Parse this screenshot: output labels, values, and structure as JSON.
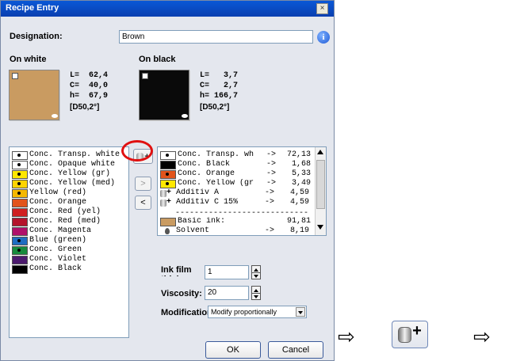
{
  "window": {
    "title": "Recipe Entry",
    "close_glyph": "×"
  },
  "designation": {
    "label": "Designation:",
    "value": "Brown",
    "info_glyph": "i"
  },
  "on_white": {
    "label": "On white",
    "swatch_color": "#c99b61",
    "metrics": [
      "L=  62,4",
      "C=  40,0",
      "h=  67,9"
    ],
    "illuminant": "[D50,2°]"
  },
  "on_black": {
    "label": "On black",
    "swatch_color": "#0a0a0a",
    "metrics": [
      "L=   3,7",
      "C=   2,7",
      "h= 166,7"
    ],
    "illuminant": "[D50,2°]"
  },
  "available_inks": [
    {
      "label": "Conc. Transp. white",
      "color": "#ffffff",
      "dot": true
    },
    {
      "label": "Conc. Opaque white",
      "color": "#ffffff",
      "dot": true
    },
    {
      "label": "Conc. Yellow (gr)",
      "color": "#ffe800",
      "dot": true
    },
    {
      "label": "Conc. Yellow (med)",
      "color": "#ffd400",
      "dot": true
    },
    {
      "label": "Yellow (red)",
      "color": "#f5b800",
      "dot": true
    },
    {
      "label": "Conc. Orange",
      "color": "#e2541b",
      "dot": false
    },
    {
      "label": "Conc. Red (yel)",
      "color": "#d02020",
      "dot": false
    },
    {
      "label": "Conc. Red (med)",
      "color": "#b4142c",
      "dot": false
    },
    {
      "label": "Conc. Magenta",
      "color": "#b0106a",
      "dot": false
    },
    {
      "label": "Blue (green)",
      "color": "#1f6cc0",
      "dot": true
    },
    {
      "label": "Conc. Green",
      "color": "#178a3c",
      "dot": true
    },
    {
      "label": "Conc. Violet",
      "color": "#4c1a6e",
      "dot": false
    },
    {
      "label": "Conc. Black",
      "color": "#000000",
      "dot": false
    }
  ],
  "recipe": {
    "rows": [
      {
        "label": "Conc. Transp. wh",
        "value": "72,13",
        "color": "#ffffff",
        "dot": true,
        "icon": ""
      },
      {
        "label": "Conc. Black",
        "value": "1,68",
        "color": "#000000",
        "dot": false,
        "icon": ""
      },
      {
        "label": "Conc. Orange",
        "value": "5,33",
        "color": "#e2541b",
        "dot": true,
        "icon": ""
      },
      {
        "label": "Conc. Yellow (gr",
        "value": "3,49",
        "color": "#ffe800",
        "dot": true,
        "icon": ""
      },
      {
        "label": "Additiv A",
        "value": "4,59",
        "color": "",
        "dot": false,
        "icon": "additive"
      },
      {
        "label": "Additiv C 15%",
        "value": "4,59",
        "color": "",
        "dot": false,
        "icon": "additive"
      }
    ],
    "arrow": "->",
    "divider": "-----------------------------",
    "basic_ink": {
      "label": "Basic ink:",
      "value": "91,81",
      "color": "#c99b61"
    },
    "solvent": {
      "label": "Solvent",
      "value": "8,19",
      "arrow": "->"
    }
  },
  "transfer_buttons": {
    "add_additive": "+",
    "move_right": ">",
    "move_left": "<"
  },
  "ink_film": {
    "label": "Ink film thickness:",
    "value": "1"
  },
  "viscosity": {
    "label": "Viscosity:",
    "value": "20"
  },
  "modification": {
    "label": "Modification",
    "value": "Modify proportionally"
  },
  "buttons": {
    "ok": "OK",
    "cancel": "Cancel"
  },
  "annotation": {
    "arrow": "⇨",
    "highlight_color": "#e01010"
  }
}
